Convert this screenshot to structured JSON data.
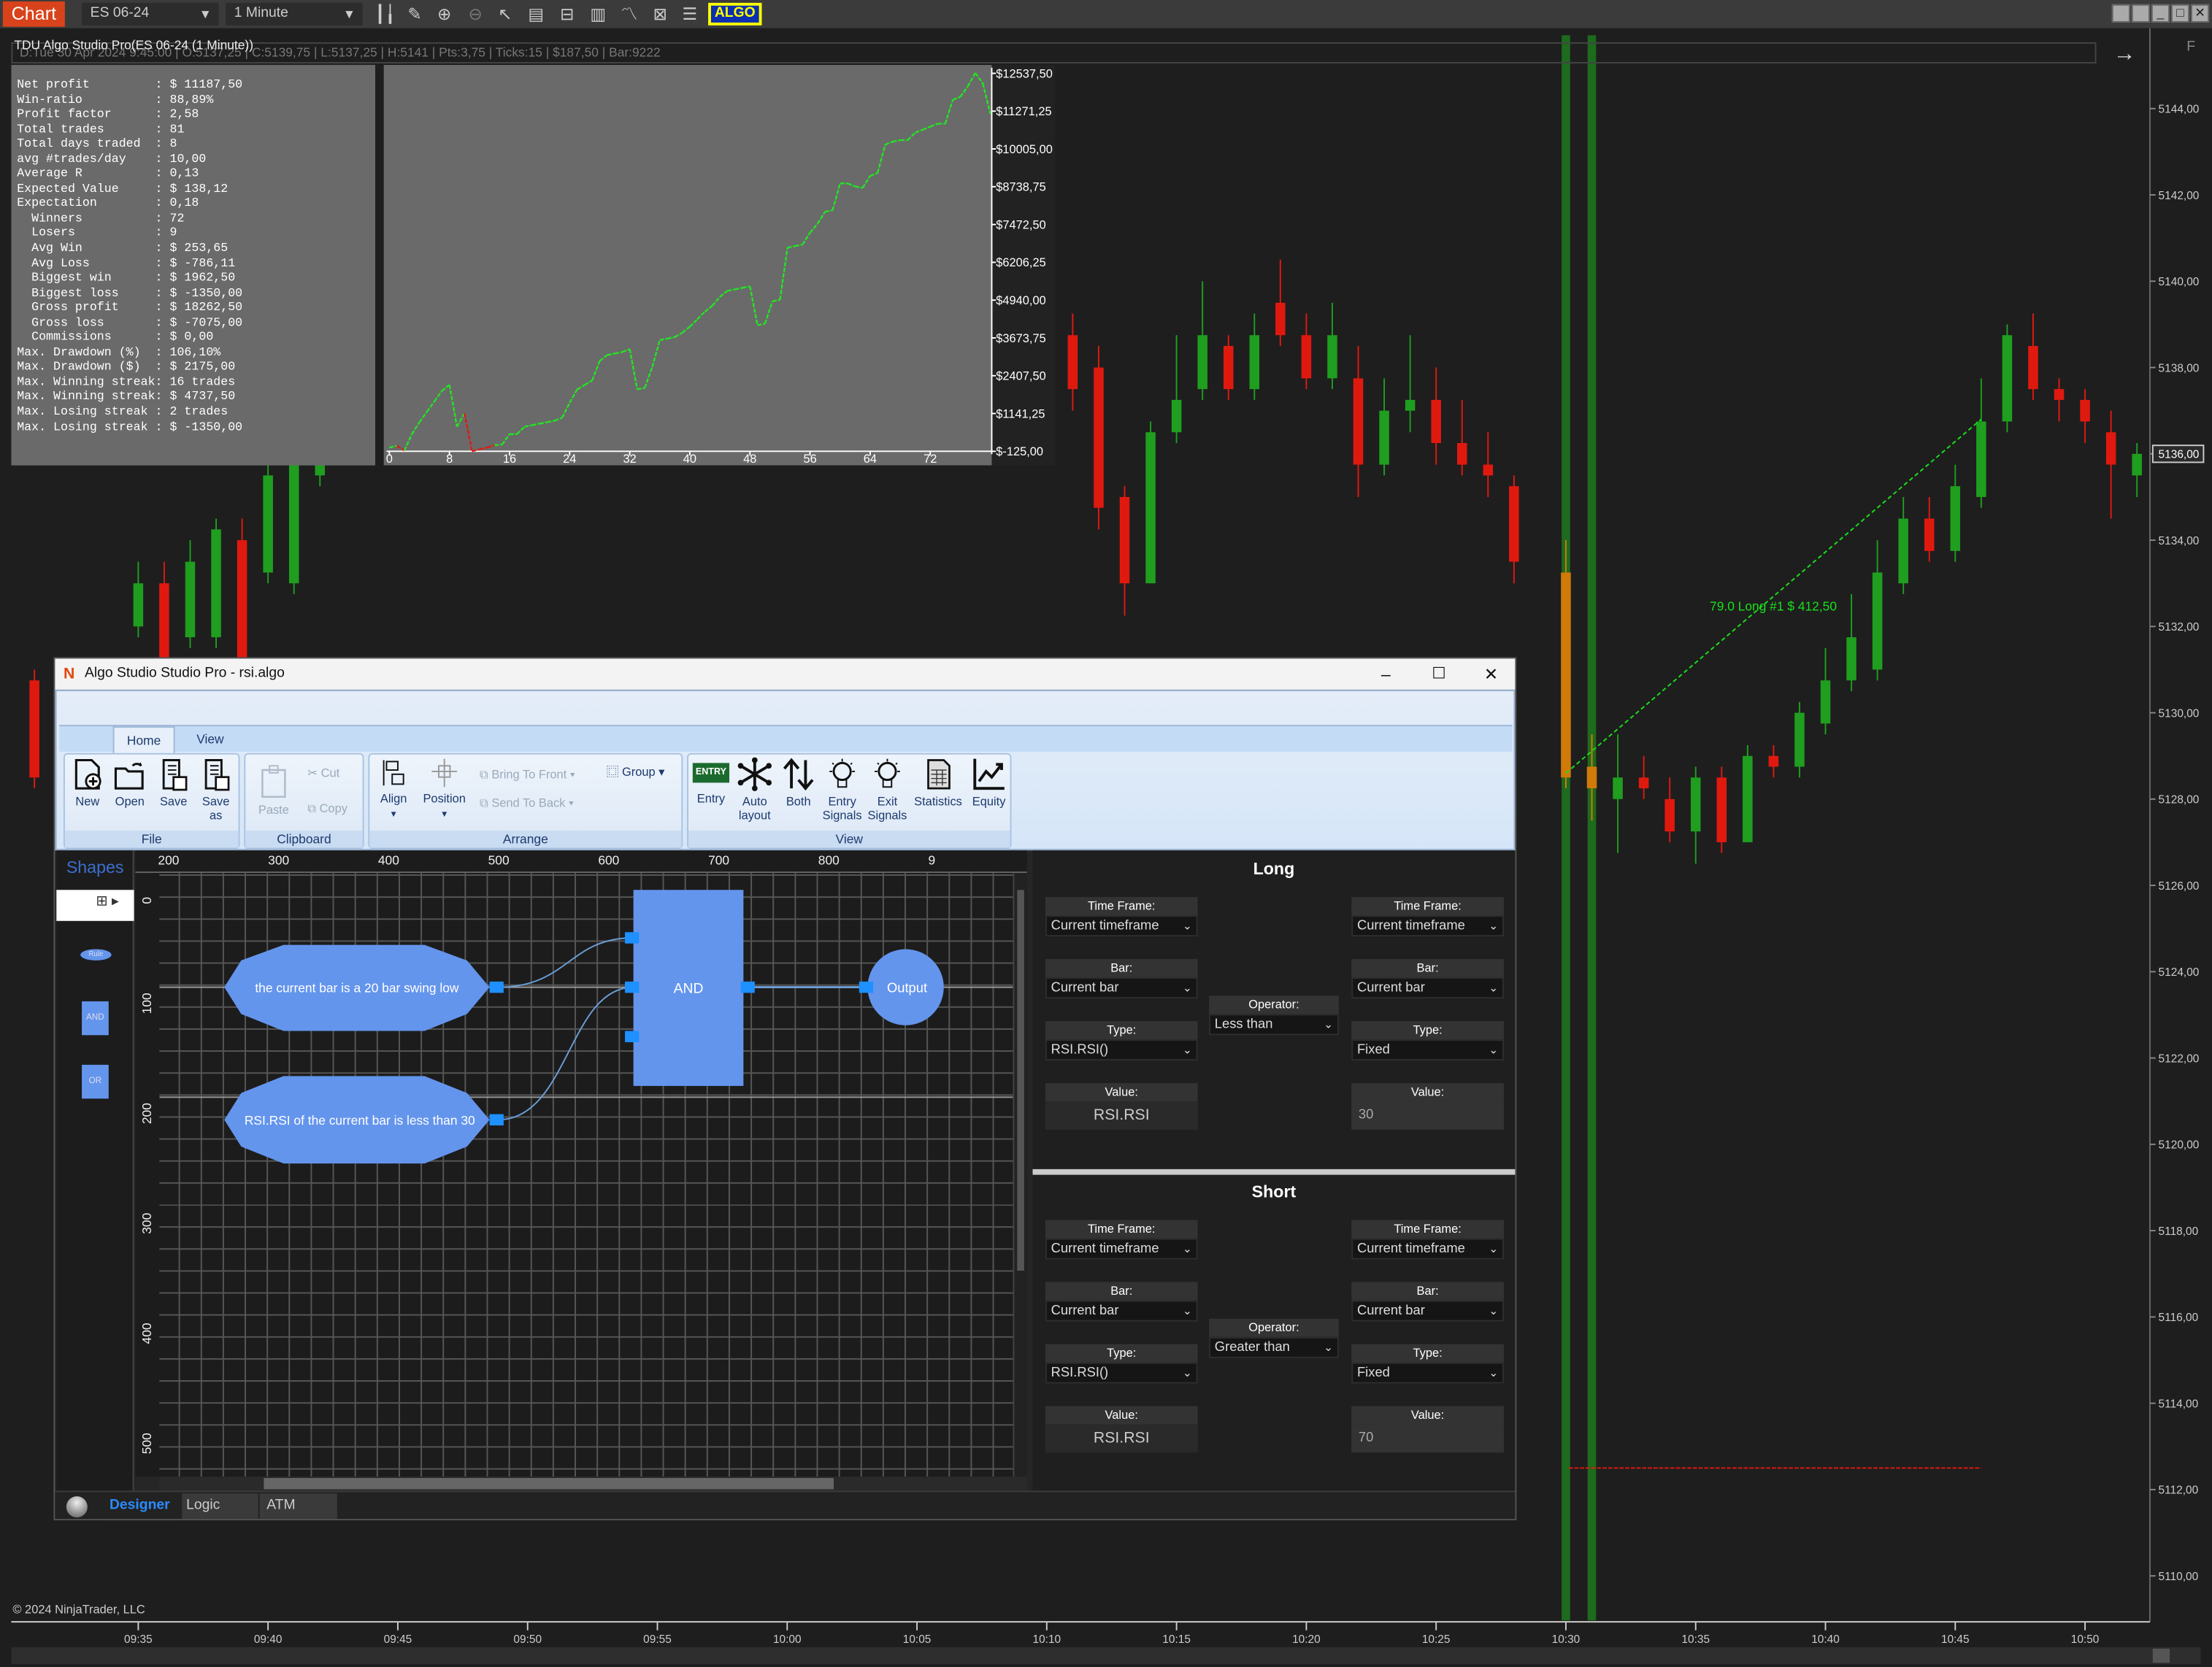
{
  "toolbar": {
    "chart_tab": "Chart",
    "instrument": "ES 06-24",
    "interval": "1 Minute",
    "algo_button": "ALGO",
    "icons": [
      "bar-type-icon",
      "pencil-icon",
      "zoom-in-icon",
      "zoom-out-icon",
      "pointer-icon",
      "data-box-icon",
      "properties-icon",
      "chart-trader-icon",
      "drawing-tools-icon",
      "strategies-icon",
      "indicators-icon"
    ]
  },
  "chart": {
    "indicator_label": "TDU Algo Studio Pro(ES 06-24 (1 Minute))",
    "data_line": "D:Tue 30 Apr 2024 9:45:00 | O:5137,25 | C:5139,75 | L:5137,25 | H:5141 | Pts:3,75 | Ticks:15 | $187,50 | Bar:9222",
    "price_labels": [
      "5144,00",
      "5142,00",
      "5140,00",
      "5138,00",
      "5136,00",
      "5134,00",
      "5132,00",
      "5130,00",
      "5128,00",
      "5126,00",
      "5124,00",
      "5122,00",
      "5120,00",
      "5118,00",
      "5116,00",
      "5114,00",
      "5112,00",
      "5110,00"
    ],
    "price_values": [
      5144,
      5142,
      5140,
      5138,
      5136,
      5134,
      5132,
      5130,
      5128,
      5126,
      5124,
      5122,
      5120,
      5118,
      5116,
      5114,
      5112,
      5110
    ],
    "current_price": "5136,00",
    "time_labels": [
      "09:35",
      "09:40",
      "09:45",
      "09:50",
      "09:55",
      "10:00",
      "10:05",
      "10:10",
      "10:15",
      "10:20",
      "10:25",
      "10:30",
      "10:35",
      "10:40",
      "10:45",
      "10:50"
    ],
    "colors": {
      "up": "#1f9e1f",
      "down": "#e0190f",
      "highlight": "#d07a0a",
      "signal_bar": "#1d6b1d",
      "trade_line": "#19e019",
      "stop_line": "#e0190f"
    },
    "candles": [
      [
        "09:31",
        5130.75,
        5131,
        5128.25,
        5128.5
      ],
      [
        "09:35",
        5132,
        5133.5,
        5131.75,
        5133
      ],
      [
        "09:36",
        5133,
        5133.5,
        5130.75,
        5131.25
      ],
      [
        "09:37",
        5131.75,
        5134,
        5131.5,
        5133.5
      ],
      [
        "09:38",
        5131.75,
        5134.5,
        5131.5,
        5134.25
      ],
      [
        "09:39",
        5134,
        5134.5,
        5130.75,
        5131.25
      ],
      [
        "09:40",
        5133.25,
        5136.25,
        5133,
        5135.5
      ],
      [
        "09:41",
        5133,
        5137,
        5132.75,
        5136
      ],
      [
        "09:42",
        5135.5,
        5137.5,
        5135.25,
        5136
      ],
      [
        "10:11",
        5138.75,
        5139.25,
        5137,
        5137.5
      ],
      [
        "10:12",
        5138,
        5138.5,
        5134.25,
        5134.75
      ],
      [
        "10:13",
        5135,
        5135.25,
        5132.25,
        5133
      ],
      [
        "10:14",
        5133,
        5136.75,
        5133,
        5136.5
      ],
      [
        "10:15",
        5136.5,
        5138.75,
        5136.25,
        5137.25
      ],
      [
        "10:16",
        5137.5,
        5140,
        5137.25,
        5138.75
      ],
      [
        "10:17",
        5138.5,
        5138.75,
        5137.25,
        5137.5
      ],
      [
        "10:18",
        5137.5,
        5139.25,
        5137.25,
        5138.75
      ],
      [
        "10:19",
        5139.5,
        5140.5,
        5138.5,
        5138.75
      ],
      [
        "10:20",
        5138.75,
        5139.25,
        5137.5,
        5137.75
      ],
      [
        "10:21",
        5137.75,
        5139.5,
        5137.5,
        5138.75
      ],
      [
        "10:22",
        5137.75,
        5138.5,
        5135,
        5135.75
      ],
      [
        "10:23",
        5135.75,
        5137.75,
        5135.5,
        5137
      ],
      [
        "10:24",
        5137,
        5138.75,
        5136.5,
        5137.25
      ],
      [
        "10:25",
        5137.25,
        5138,
        5135.75,
        5136.25
      ],
      [
        "10:26",
        5136.25,
        5137.25,
        5135.5,
        5135.75
      ],
      [
        "10:27",
        5135.75,
        5136.5,
        5135,
        5135.5
      ],
      [
        "10:28",
        5135.25,
        5135.5,
        5133,
        5133.5
      ],
      [
        "10:30",
        5133.25,
        5134,
        5128.25,
        5128.5,
        "highlight"
      ],
      [
        "10:31",
        5128.75,
        5129.5,
        5127.5,
        5128.25,
        "highlight"
      ],
      [
        "10:32",
        5128,
        5129.5,
        5126.75,
        5128.5
      ],
      [
        "10:33",
        5128.5,
        5129,
        5128,
        5128.25
      ],
      [
        "10:34",
        5128,
        5128.5,
        5127,
        5127.25
      ],
      [
        "10:35",
        5127.25,
        5128.75,
        5126.5,
        5128.5
      ],
      [
        "10:36",
        5128.5,
        5128.75,
        5126.75,
        5127
      ],
      [
        "10:37",
        5127,
        5129.25,
        5127,
        5129
      ],
      [
        "10:38",
        5129,
        5129.25,
        5128.5,
        5128.75
      ],
      [
        "10:39",
        5128.75,
        5130.25,
        5128.5,
        5130
      ],
      [
        "10:40",
        5129.75,
        5131.5,
        5129.5,
        5130.75
      ],
      [
        "10:41",
        5130.75,
        5132.75,
        5130.5,
        5131.75
      ],
      [
        "10:42",
        5131,
        5134,
        5130.75,
        5133.25
      ],
      [
        "10:43",
        5133,
        5135,
        5132.75,
        5134.5
      ],
      [
        "10:44",
        5134.5,
        5135,
        5133.5,
        5133.75
      ],
      [
        "10:45",
        5133.75,
        5135.75,
        5133.5,
        5135.25
      ],
      [
        "10:46",
        5135,
        5137.75,
        5134.75,
        5136.75
      ],
      [
        "10:47",
        5136.75,
        5139,
        5136.5,
        5138.75
      ],
      [
        "10:48",
        5138.5,
        5139.25,
        5137.25,
        5137.5
      ],
      [
        "10:49",
        5137.5,
        5137.75,
        5136.75,
        5137.25
      ],
      [
        "10:50",
        5137.25,
        5137.5,
        5136.25,
        5136.75
      ],
      [
        "10:51",
        5136.5,
        5137,
        5134.5,
        5135.75
      ],
      [
        "10:52",
        5135.5,
        5136.25,
        5135,
        5136
      ]
    ],
    "signal_bars": [
      "10:30",
      "10:31"
    ],
    "trade": {
      "label": "79.0 Long #1 $ 412,50",
      "entry_time": "10:30",
      "entry_price": 5128.6,
      "exit_time": "10:46",
      "exit_price": 5136.8,
      "stop_price": 5112.5
    },
    "copyright": "© 2024 NinjaTrader, LLC"
  },
  "stats": [
    {
      "label": "Net profit",
      "value": "$ 11187,50"
    },
    {
      "label": "Win-ratio",
      "value": "88,89%"
    },
    {
      "label": "Profit factor",
      "value": "2,58"
    },
    {
      "label": "Total trades",
      "value": "81"
    },
    {
      "label": "Total days traded",
      "value": "8"
    },
    {
      "label": "avg #trades/day",
      "value": "10,00"
    },
    {
      "label": "Average R",
      "value": "0,13"
    },
    {
      "label": "Expected Value",
      "value": "$ 138,12"
    },
    {
      "label": "Expectation",
      "value": "0,18"
    },
    {
      "label": "  Winners",
      "value": "72"
    },
    {
      "label": "  Losers",
      "value": "9"
    },
    {
      "label": "  Avg Win",
      "value": "$ 253,65"
    },
    {
      "label": "  Avg Loss",
      "value": "$ -786,11"
    },
    {
      "label": "  Biggest win",
      "value": "$ 1962,50"
    },
    {
      "label": "  Biggest loss",
      "value": "$ -1350,00"
    },
    {
      "label": "  Gross profit",
      "value": "$ 18262,50"
    },
    {
      "label": "  Gross loss",
      "value": "$ -7075,00"
    },
    {
      "label": "  Commissions",
      "value": "$ 0,00"
    },
    {
      "label": "Max. Drawdown (%)",
      "value": "106,10%"
    },
    {
      "label": "Max. Drawdown ($)",
      "value": "$ 2175,00"
    },
    {
      "label": "Max. Winning streak",
      "value": "16 trades"
    },
    {
      "label": "Max. Winning streak",
      "value": "$ 4737,50"
    },
    {
      "label": "Max. Losing streak",
      "value": "2 trades"
    },
    {
      "label": "Max. Losing streak",
      "value": "$ -1350,00"
    }
  ],
  "equity_chart": {
    "type": "line",
    "y_labels": [
      "$12537,50",
      "$11271,25",
      "$10005,00",
      "$8738,75",
      "$7472,50",
      "$6206,25",
      "$4940,00",
      "$3673,75",
      "$2407,50",
      "$1141,25",
      "$-125,00"
    ],
    "x_labels": [
      "0",
      "8",
      "16",
      "24",
      "32",
      "40",
      "48",
      "56",
      "64",
      "72"
    ],
    "x_ticks": [
      0,
      8,
      16,
      24,
      32,
      40,
      48,
      56,
      64,
      72
    ],
    "ylim": [
      -125,
      12537.5
    ],
    "xlim": [
      0,
      80
    ],
    "values": [
      0,
      60,
      -100,
      450,
      850,
      1200,
      1550,
      1900,
      2100,
      700,
      1150,
      -125,
      -60,
      0,
      80,
      100,
      450,
      450,
      700,
      750,
      800,
      850,
      900,
      1000,
      1500,
      1950,
      2100,
      2250,
      2900,
      3100,
      3150,
      3200,
      3300,
      1950,
      2000,
      2700,
      3600,
      3650,
      3700,
      3850,
      4050,
      4300,
      4550,
      4750,
      5050,
      5250,
      5300,
      5350,
      5400,
      4100,
      4150,
      4900,
      4950,
      6700,
      6750,
      6800,
      7200,
      7500,
      7900,
      7950,
      8850,
      8850,
      8750,
      8700,
      9100,
      9200,
      10150,
      10250,
      10300,
      10300,
      10550,
      10650,
      10750,
      10850,
      10850,
      11650,
      11750,
      12100,
      12550,
      12200,
      11187.5
    ],
    "drawdown_segments": [
      [
        1,
        2
      ],
      [
        10,
        14
      ]
    ],
    "colors": {
      "line": "#22e622",
      "drawdown": "#e0190f",
      "background": "#6a6a6a"
    }
  },
  "studio": {
    "title": "Algo Studio Studio Pro - rsi.algo",
    "tabs": [
      "Home",
      "View"
    ],
    "groups": {
      "file": {
        "caption": "File",
        "buttons": [
          "New",
          "Open",
          "Save",
          "Save as"
        ]
      },
      "clipboard": {
        "caption": "Clipboard",
        "paste": "Paste",
        "cut": "Cut",
        "copy": "Copy"
      },
      "arrange": {
        "caption": "Arrange",
        "align": "Align",
        "position": "Position",
        "bring_to_front": "Bring To Front",
        "send_to_back": "Send To Back",
        "group": "Group"
      },
      "view": {
        "caption": "View",
        "entry_badge": "ENTRY",
        "buttons": [
          "Entry",
          "Auto layout",
          "Both",
          "Entry Signals",
          "Exit Signals",
          "Statistics",
          "Equity"
        ]
      }
    },
    "shapes_title": "Shapes",
    "palette": [
      "Rule",
      "AND",
      "OR"
    ],
    "ruler_x": [
      "200",
      "300",
      "400",
      "500",
      "600",
      "700",
      "800",
      "9"
    ],
    "ruler_y": [
      "0",
      "100",
      "200",
      "300",
      "400",
      "500"
    ],
    "diagram": {
      "rule1": "the current bar is a 20 bar swing low",
      "rule2": "RSI.RSI of the current bar is less than 30",
      "and": "AND",
      "output": "Output"
    },
    "long": {
      "title": "Long",
      "left": {
        "timeframe_label": "Time Frame:",
        "timeframe": "Current timeframe",
        "bar_label": "Bar:",
        "bar": "Current bar",
        "type_label": "Type:",
        "type": "RSI.RSI()",
        "value_label": "Value:",
        "value": "RSI.RSI"
      },
      "operator_label": "Operator:",
      "operator": "Less than",
      "right": {
        "timeframe_label": "Time Frame:",
        "timeframe": "Current timeframe",
        "bar_label": "Bar:",
        "bar": "Current bar",
        "type_label": "Type:",
        "type": "Fixed",
        "value_label": "Value:",
        "value": "30"
      }
    },
    "short": {
      "title": "Short",
      "left": {
        "timeframe_label": "Time Frame:",
        "timeframe": "Current timeframe",
        "bar_label": "Bar:",
        "bar": "Current bar",
        "type_label": "Type:",
        "type": "RSI.RSI()",
        "value_label": "Value:",
        "value": "RSI.RSI"
      },
      "operator_label": "Operator:",
      "operator": "Greater than",
      "right": {
        "timeframe_label": "Time Frame:",
        "timeframe": "Current timeframe",
        "bar_label": "Bar:",
        "bar": "Current bar",
        "type_label": "Type:",
        "type": "Fixed",
        "value_label": "Value:",
        "value": "70"
      }
    },
    "bottom_tabs": [
      "Designer",
      "Logic",
      "ATM"
    ],
    "active_bottom_tab": "Designer",
    "accent": "#6495ed"
  }
}
